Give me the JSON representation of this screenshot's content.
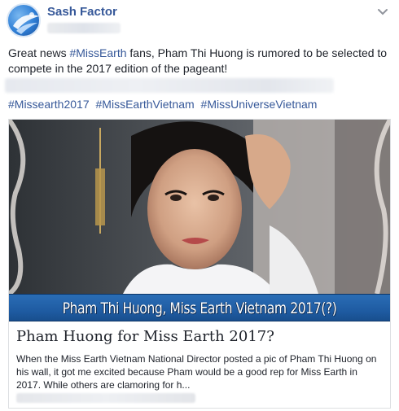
{
  "post": {
    "page_name": "Sash Factor",
    "text_before_tag": "Great news ",
    "tag_missearth": "#MissEarth",
    "text_after_tag": " fans, Pham Thi Huong is rumored to be selected to compete in the 2017 edition of the pageant!",
    "hashtags": [
      "#Missearth2017",
      "#MissEarthVietnam",
      "#MissUniverseVietnam"
    ]
  },
  "link_card": {
    "image_caption": "Pham Thi Huong, Miss Earth Vietnam 2017(?)",
    "title": "Pham Huong for Miss Earth 2017?",
    "description": "When the Miss Earth Vietnam National Director posted a pic of Pham Thi Huong on his wall, it got me excited because Pham would be a good rep for Miss Earth in 2017. While others are clamoring for h..."
  },
  "icons": {
    "avatar": "sash-factor-logo",
    "menu": "chevron-down-icon"
  },
  "colors": {
    "link": "#365899",
    "caption_band": "#1f5ca3",
    "text": "#1d2129"
  }
}
